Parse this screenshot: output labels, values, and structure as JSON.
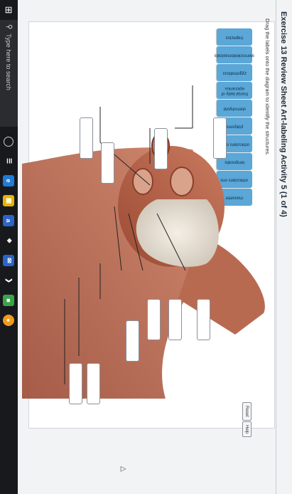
{
  "page": {
    "title": "Exercise 13 Review Sheet Art-labeling Activity 5 (1 of 4)",
    "instruction": "Drag the labels onto the diagram to identify the structures."
  },
  "labels": [
    {
      "text": "trapezius"
    },
    {
      "text": "sternocleidomastoids"
    },
    {
      "text": "zygomaticus"
    },
    {
      "text": "frontal belly of epicranius"
    },
    {
      "text": "sternohyoid"
    },
    {
      "text": "platysma"
    },
    {
      "text": "orbicularis oculi"
    },
    {
      "text": "temporalis"
    },
    {
      "text": "orbicularis oris"
    },
    {
      "text": "masseter"
    }
  ],
  "buttons": {
    "reset": "Reset",
    "help": "Help"
  },
  "taskbar": {
    "search_placeholder": "Type here to search"
  },
  "colors": {
    "chip": "#5aa7d8",
    "taskbar": "#17191c",
    "muscle": "#b8624a"
  }
}
